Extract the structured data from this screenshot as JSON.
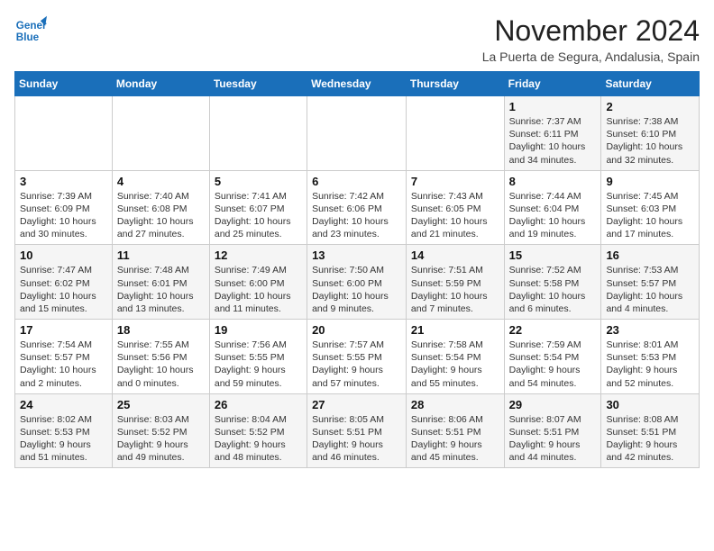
{
  "header": {
    "logo_line1": "General",
    "logo_line2": "Blue",
    "month": "November 2024",
    "location": "La Puerta de Segura, Andalusia, Spain"
  },
  "weekdays": [
    "Sunday",
    "Monday",
    "Tuesday",
    "Wednesday",
    "Thursday",
    "Friday",
    "Saturday"
  ],
  "weeks": [
    [
      {
        "day": "",
        "info": ""
      },
      {
        "day": "",
        "info": ""
      },
      {
        "day": "",
        "info": ""
      },
      {
        "day": "",
        "info": ""
      },
      {
        "day": "",
        "info": ""
      },
      {
        "day": "1",
        "info": "Sunrise: 7:37 AM\nSunset: 6:11 PM\nDaylight: 10 hours and 34 minutes."
      },
      {
        "day": "2",
        "info": "Sunrise: 7:38 AM\nSunset: 6:10 PM\nDaylight: 10 hours and 32 minutes."
      }
    ],
    [
      {
        "day": "3",
        "info": "Sunrise: 7:39 AM\nSunset: 6:09 PM\nDaylight: 10 hours and 30 minutes."
      },
      {
        "day": "4",
        "info": "Sunrise: 7:40 AM\nSunset: 6:08 PM\nDaylight: 10 hours and 27 minutes."
      },
      {
        "day": "5",
        "info": "Sunrise: 7:41 AM\nSunset: 6:07 PM\nDaylight: 10 hours and 25 minutes."
      },
      {
        "day": "6",
        "info": "Sunrise: 7:42 AM\nSunset: 6:06 PM\nDaylight: 10 hours and 23 minutes."
      },
      {
        "day": "7",
        "info": "Sunrise: 7:43 AM\nSunset: 6:05 PM\nDaylight: 10 hours and 21 minutes."
      },
      {
        "day": "8",
        "info": "Sunrise: 7:44 AM\nSunset: 6:04 PM\nDaylight: 10 hours and 19 minutes."
      },
      {
        "day": "9",
        "info": "Sunrise: 7:45 AM\nSunset: 6:03 PM\nDaylight: 10 hours and 17 minutes."
      }
    ],
    [
      {
        "day": "10",
        "info": "Sunrise: 7:47 AM\nSunset: 6:02 PM\nDaylight: 10 hours and 15 minutes."
      },
      {
        "day": "11",
        "info": "Sunrise: 7:48 AM\nSunset: 6:01 PM\nDaylight: 10 hours and 13 minutes."
      },
      {
        "day": "12",
        "info": "Sunrise: 7:49 AM\nSunset: 6:00 PM\nDaylight: 10 hours and 11 minutes."
      },
      {
        "day": "13",
        "info": "Sunrise: 7:50 AM\nSunset: 6:00 PM\nDaylight: 10 hours and 9 minutes."
      },
      {
        "day": "14",
        "info": "Sunrise: 7:51 AM\nSunset: 5:59 PM\nDaylight: 10 hours and 7 minutes."
      },
      {
        "day": "15",
        "info": "Sunrise: 7:52 AM\nSunset: 5:58 PM\nDaylight: 10 hours and 6 minutes."
      },
      {
        "day": "16",
        "info": "Sunrise: 7:53 AM\nSunset: 5:57 PM\nDaylight: 10 hours and 4 minutes."
      }
    ],
    [
      {
        "day": "17",
        "info": "Sunrise: 7:54 AM\nSunset: 5:57 PM\nDaylight: 10 hours and 2 minutes."
      },
      {
        "day": "18",
        "info": "Sunrise: 7:55 AM\nSunset: 5:56 PM\nDaylight: 10 hours and 0 minutes."
      },
      {
        "day": "19",
        "info": "Sunrise: 7:56 AM\nSunset: 5:55 PM\nDaylight: 9 hours and 59 minutes."
      },
      {
        "day": "20",
        "info": "Sunrise: 7:57 AM\nSunset: 5:55 PM\nDaylight: 9 hours and 57 minutes."
      },
      {
        "day": "21",
        "info": "Sunrise: 7:58 AM\nSunset: 5:54 PM\nDaylight: 9 hours and 55 minutes."
      },
      {
        "day": "22",
        "info": "Sunrise: 7:59 AM\nSunset: 5:54 PM\nDaylight: 9 hours and 54 minutes."
      },
      {
        "day": "23",
        "info": "Sunrise: 8:01 AM\nSunset: 5:53 PM\nDaylight: 9 hours and 52 minutes."
      }
    ],
    [
      {
        "day": "24",
        "info": "Sunrise: 8:02 AM\nSunset: 5:53 PM\nDaylight: 9 hours and 51 minutes."
      },
      {
        "day": "25",
        "info": "Sunrise: 8:03 AM\nSunset: 5:52 PM\nDaylight: 9 hours and 49 minutes."
      },
      {
        "day": "26",
        "info": "Sunrise: 8:04 AM\nSunset: 5:52 PM\nDaylight: 9 hours and 48 minutes."
      },
      {
        "day": "27",
        "info": "Sunrise: 8:05 AM\nSunset: 5:51 PM\nDaylight: 9 hours and 46 minutes."
      },
      {
        "day": "28",
        "info": "Sunrise: 8:06 AM\nSunset: 5:51 PM\nDaylight: 9 hours and 45 minutes."
      },
      {
        "day": "29",
        "info": "Sunrise: 8:07 AM\nSunset: 5:51 PM\nDaylight: 9 hours and 44 minutes."
      },
      {
        "day": "30",
        "info": "Sunrise: 8:08 AM\nSunset: 5:51 PM\nDaylight: 9 hours and 42 minutes."
      }
    ]
  ]
}
